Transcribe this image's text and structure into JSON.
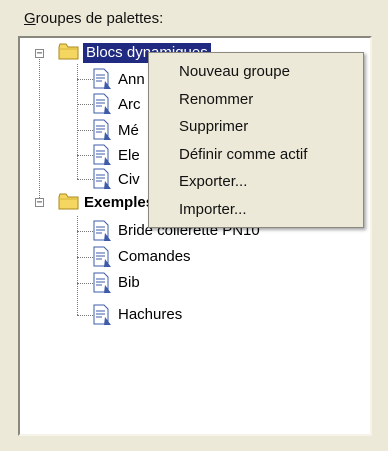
{
  "panel": {
    "title_underlined": "G",
    "title_rest": "roupes de palettes:"
  },
  "tree": {
    "groups": [
      {
        "label": "Blocs dynamiques",
        "expanded": true,
        "selected": true,
        "children": [
          "Ann",
          "Arc",
          "Mé",
          "Ele",
          "Civ"
        ]
      },
      {
        "label": "Exemples",
        "expanded": true,
        "selected": false,
        "children": [
          "Bride collerette PN10",
          "Comandes",
          "Bib",
          "Hachures"
        ]
      }
    ]
  },
  "context_menu": {
    "items": [
      "Nouveau groupe",
      "Renommer",
      "Supprimer",
      "Définir comme actif",
      "Exporter...",
      "Importer..."
    ]
  },
  "colors": {
    "selection": "#1f2a80",
    "background": "#ece9d8"
  },
  "icons": {
    "folder": "folder-icon",
    "palette": "palette-doc-icon",
    "expander": "minus-box-icon"
  }
}
